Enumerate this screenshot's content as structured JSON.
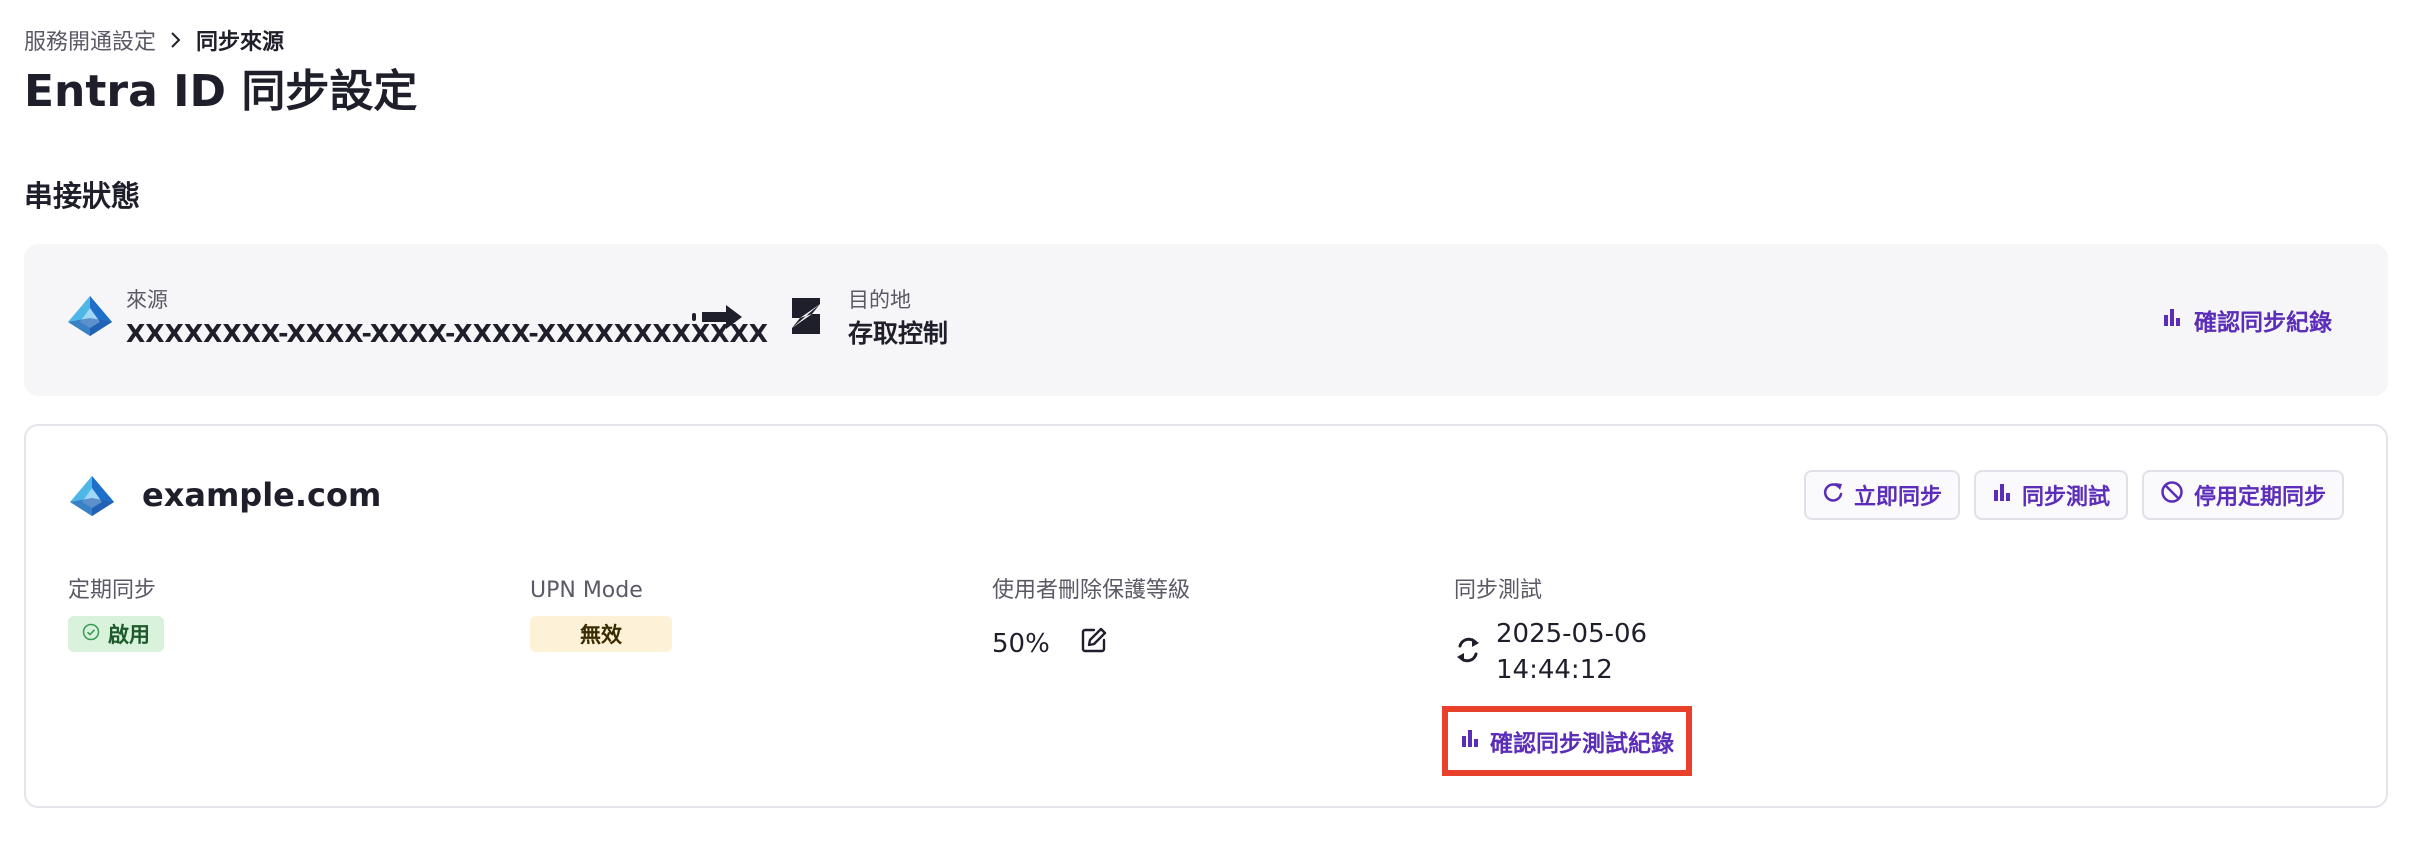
{
  "breadcrumb": {
    "parent": "服務開通設定",
    "current": "同步來源"
  },
  "page": {
    "title": "Entra ID 同步設定"
  },
  "section": {
    "title": "串接狀態"
  },
  "connection": {
    "source_label": "來源",
    "source_value": "XXXXXXXX-XXXX-XXXX-XXXX-XXXXXXXXXXXX",
    "dest_label": "目的地",
    "dest_value": "存取控制",
    "history_button": "確認同步紀錄"
  },
  "domain_card": {
    "name": "example.com",
    "actions": {
      "sync_now": "立即同步",
      "sync_test": "同步測試",
      "disable_schedule": "停用定期同步"
    },
    "fields": {
      "scheduled_label": "定期同步",
      "scheduled_value": "啟用",
      "upn_label": "UPN Mode",
      "upn_value": "無效",
      "protection_label": "使用者刪除保護等級",
      "protection_value": "50%",
      "sync_test_label": "同步測試",
      "sync_test_date": "2025-05-06",
      "sync_test_time": "14:44:12",
      "sync_test_history_button": "確認同步測試紀錄"
    }
  },
  "colors": {
    "accent": "#5b2db8",
    "highlight_border": "#e8402a",
    "success_bg": "#d8f2dc",
    "warning_bg": "#fdf2d8"
  }
}
